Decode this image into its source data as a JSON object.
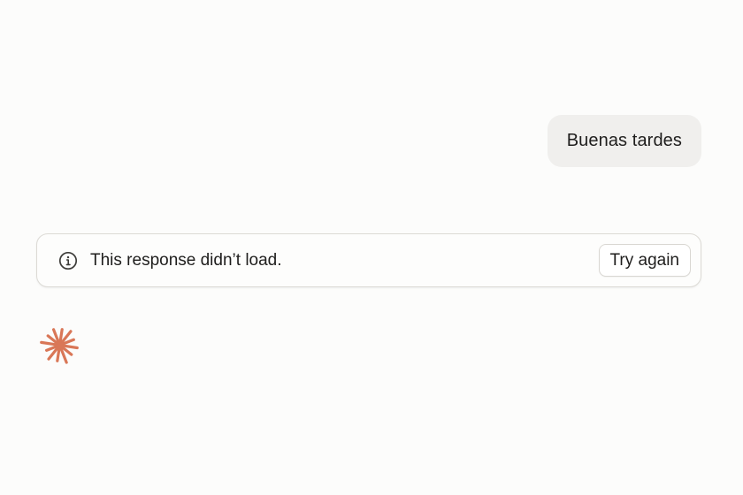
{
  "conversation": {
    "user_message": "Buenas tardes"
  },
  "error_banner": {
    "icon": "info-icon",
    "message": "This response didn’t load.",
    "retry_label": "Try again"
  },
  "assistant": {
    "icon": "spark-logo-icon",
    "accent_color": "#d97757"
  }
}
